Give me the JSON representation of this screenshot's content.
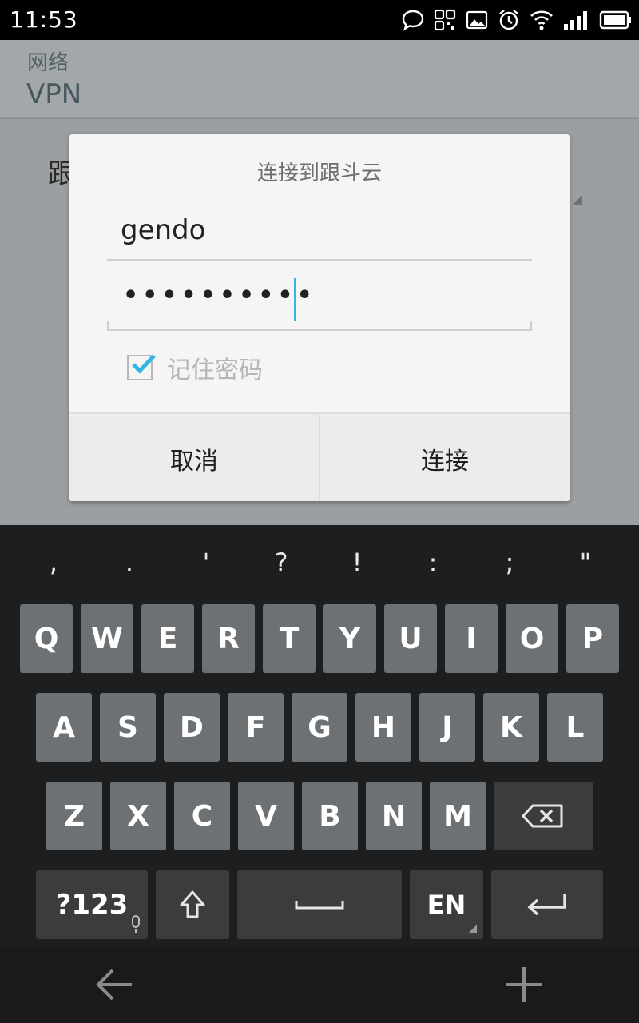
{
  "status_bar": {
    "time": "11:53"
  },
  "header": {
    "breadcrumb": "网络",
    "title": "VPN"
  },
  "background_list": {
    "item_text": "跟"
  },
  "dialog": {
    "title": "连接到跟斗云",
    "username": "gendo",
    "password_mask": "••••••••••",
    "remember_label": "记住密码",
    "remember_checked": true,
    "cancel_label": "取消",
    "connect_label": "连接"
  },
  "keyboard": {
    "suggestions": [
      ",",
      ".",
      "'",
      "?",
      "!",
      ":",
      ";",
      "\""
    ],
    "row1": [
      "Q",
      "W",
      "E",
      "R",
      "T",
      "Y",
      "U",
      "I",
      "O",
      "P"
    ],
    "row2": [
      "A",
      "S",
      "D",
      "F",
      "G",
      "H",
      "J",
      "K",
      "L"
    ],
    "row3": [
      "Z",
      "X",
      "C",
      "V",
      "B",
      "N",
      "M"
    ],
    "symbols_label": "?123",
    "language_label": "EN",
    "accent_color": "#33b5e5"
  },
  "nav_bar": {
    "back_icon": "back-arrow-icon",
    "add_icon": "plus-icon"
  }
}
